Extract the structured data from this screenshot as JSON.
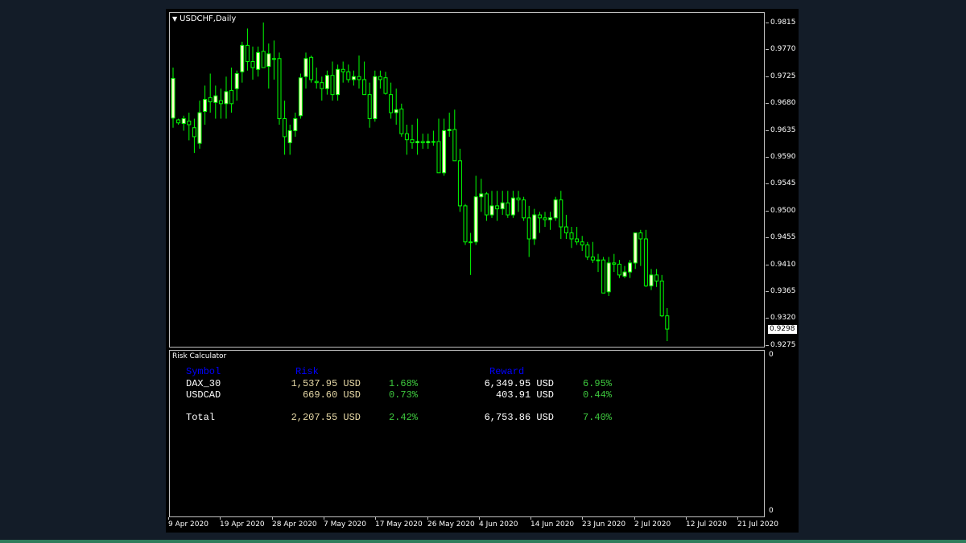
{
  "chart": {
    "symbol_title": "USDCHF,Daily",
    "dropdown_icon": "triangle-down-icon",
    "bull_color": "#ffffcc",
    "bear_color": "#000000",
    "wick_color": "#00ff00",
    "current_price": "0.9298",
    "price_labels": [
      "0.9815",
      "0.9770",
      "0.9725",
      "0.9680",
      "0.9635",
      "0.9590",
      "0.9545",
      "0.9500",
      "0.9455",
      "0.9410",
      "0.9365",
      "0.9320",
      "0.9275"
    ],
    "time_labels": [
      "9 Apr 2020",
      "19 Apr 2020",
      "28 Apr 2020",
      "7 May 2020",
      "17 May 2020",
      "26 May 2020",
      "4 Jun 2020",
      "14 Jun 2020",
      "23 Jun 2020",
      "2 Jul 2020",
      "12 Jul 2020",
      "21 Jul 2020"
    ]
  },
  "chart_data": {
    "type": "candlestick",
    "title": "USDCHF,Daily",
    "ylim": [
      0.9268,
      0.9826
    ],
    "ohlc": [
      [
        0.9651,
        0.9735,
        0.9635,
        0.9717
      ],
      [
        0.9648,
        0.965,
        0.964,
        0.9643
      ],
      [
        0.9642,
        0.9655,
        0.963,
        0.965
      ],
      [
        0.9646,
        0.966,
        0.9614,
        0.964
      ],
      [
        0.9635,
        0.965,
        0.9593,
        0.962
      ],
      [
        0.9609,
        0.968,
        0.96,
        0.966
      ],
      [
        0.9662,
        0.9705,
        0.964,
        0.9682
      ],
      [
        0.9685,
        0.9725,
        0.966,
        0.9678
      ],
      [
        0.9677,
        0.9705,
        0.965,
        0.9688
      ],
      [
        0.968,
        0.97,
        0.965,
        0.9675
      ],
      [
        0.9675,
        0.972,
        0.965,
        0.9695
      ],
      [
        0.9697,
        0.9735,
        0.966,
        0.9675
      ],
      [
        0.97,
        0.973,
        0.968,
        0.9725
      ],
      [
        0.9728,
        0.9778,
        0.971,
        0.9772
      ],
      [
        0.9772,
        0.98,
        0.973,
        0.9745
      ],
      [
        0.9745,
        0.977,
        0.9715,
        0.9735
      ],
      [
        0.9732,
        0.977,
        0.972,
        0.976
      ],
      [
        0.9762,
        0.981,
        0.9735,
        0.9735
      ],
      [
        0.9737,
        0.9775,
        0.97,
        0.9758
      ],
      [
        0.975,
        0.978,
        0.9715,
        0.975
      ],
      [
        0.975,
        0.976,
        0.964,
        0.965
      ],
      [
        0.965,
        0.968,
        0.959,
        0.962
      ],
      [
        0.961,
        0.964,
        0.959,
        0.963
      ],
      [
        0.963,
        0.966,
        0.962,
        0.965
      ],
      [
        0.9655,
        0.9725,
        0.965,
        0.9718
      ],
      [
        0.972,
        0.976,
        0.97,
        0.975
      ],
      [
        0.9752,
        0.9755,
        0.971,
        0.9715
      ],
      [
        0.9712,
        0.9735,
        0.97,
        0.971
      ],
      [
        0.971,
        0.972,
        0.968,
        0.97
      ],
      [
        0.97,
        0.973,
        0.969,
        0.9722
      ],
      [
        0.9722,
        0.9745,
        0.968,
        0.969
      ],
      [
        0.969,
        0.974,
        0.968,
        0.9732
      ],
      [
        0.9732,
        0.9745,
        0.971,
        0.9728
      ],
      [
        0.9728,
        0.974,
        0.971,
        0.9715
      ],
      [
        0.9715,
        0.973,
        0.9705,
        0.972
      ],
      [
        0.972,
        0.9755,
        0.97,
        0.9715
      ],
      [
        0.9715,
        0.9745,
        0.969,
        0.969
      ],
      [
        0.969,
        0.971,
        0.9635,
        0.965
      ],
      [
        0.965,
        0.973,
        0.9645,
        0.972
      ],
      [
        0.972,
        0.973,
        0.97,
        0.9715
      ],
      [
        0.9718,
        0.9728,
        0.969,
        0.9692
      ],
      [
        0.969,
        0.971,
        0.965,
        0.966
      ],
      [
        0.966,
        0.97,
        0.964,
        0.9665
      ],
      [
        0.9666,
        0.9675,
        0.962,
        0.9625
      ],
      [
        0.9625,
        0.964,
        0.959,
        0.9615
      ],
      [
        0.9615,
        0.964,
        0.96,
        0.961
      ],
      [
        0.961,
        0.965,
        0.959,
        0.9612
      ],
      [
        0.9612,
        0.9625,
        0.96,
        0.961
      ],
      [
        0.961,
        0.9625,
        0.96,
        0.9612
      ],
      [
        0.9612,
        0.963,
        0.9605,
        0.9612
      ],
      [
        0.9612,
        0.965,
        0.956,
        0.956
      ],
      [
        0.956,
        0.965,
        0.9555,
        0.963
      ],
      [
        0.963,
        0.966,
        0.962,
        0.9632
      ],
      [
        0.9632,
        0.9665,
        0.958,
        0.958
      ],
      [
        0.958,
        0.96,
        0.9495,
        0.9505
      ],
      [
        0.9505,
        0.9508,
        0.944,
        0.9445
      ],
      [
        0.9445,
        0.946,
        0.939,
        0.9445
      ],
      [
        0.9445,
        0.9555,
        0.944,
        0.952
      ],
      [
        0.952,
        0.955,
        0.9495,
        0.9525
      ],
      [
        0.9525,
        0.9528,
        0.948,
        0.949
      ],
      [
        0.949,
        0.953,
        0.9485,
        0.9505
      ],
      [
        0.9505,
        0.953,
        0.948,
        0.95
      ],
      [
        0.95,
        0.953,
        0.949,
        0.951
      ],
      [
        0.951,
        0.953,
        0.9485,
        0.949
      ],
      [
        0.949,
        0.953,
        0.9485,
        0.9518
      ],
      [
        0.9518,
        0.953,
        0.9495,
        0.9515
      ],
      [
        0.9515,
        0.952,
        0.948,
        0.9485
      ],
      [
        0.9485,
        0.9505,
        0.942,
        0.945
      ],
      [
        0.945,
        0.95,
        0.944,
        0.949
      ],
      [
        0.949,
        0.9495,
        0.946,
        0.9485
      ],
      [
        0.9485,
        0.9495,
        0.947,
        0.9482
      ],
      [
        0.9482,
        0.9495,
        0.9465,
        0.9485
      ],
      [
        0.9485,
        0.952,
        0.948,
        0.9515
      ],
      [
        0.9515,
        0.953,
        0.945,
        0.947
      ],
      [
        0.947,
        0.949,
        0.945,
        0.946
      ],
      [
        0.946,
        0.947,
        0.9435,
        0.945
      ],
      [
        0.945,
        0.947,
        0.944,
        0.9445
      ],
      [
        0.9445,
        0.9455,
        0.943,
        0.944
      ],
      [
        0.944,
        0.9445,
        0.9415,
        0.942
      ],
      [
        0.942,
        0.9445,
        0.941,
        0.9415
      ],
      [
        0.9415,
        0.9425,
        0.9395,
        0.9415
      ],
      [
        0.9415,
        0.942,
        0.936,
        0.936
      ],
      [
        0.9362,
        0.942,
        0.9355,
        0.941
      ],
      [
        0.941,
        0.9425,
        0.9395,
        0.9408
      ],
      [
        0.9408,
        0.9415,
        0.9385,
        0.939
      ],
      [
        0.9388,
        0.9405,
        0.9385,
        0.9395
      ],
      [
        0.9395,
        0.9415,
        0.9385,
        0.941
      ],
      [
        0.941,
        0.946,
        0.94,
        0.946
      ],
      [
        0.946,
        0.9465,
        0.9405,
        0.945
      ],
      [
        0.945,
        0.9465,
        0.937,
        0.9372
      ],
      [
        0.9372,
        0.94,
        0.9365,
        0.939
      ],
      [
        0.939,
        0.94,
        0.937,
        0.938
      ],
      [
        0.938,
        0.939,
        0.932,
        0.9322
      ],
      [
        0.9322,
        0.9335,
        0.928,
        0.93
      ]
    ]
  },
  "risk_calculator": {
    "title": "Risk Calculator",
    "headers": {
      "symbol": "Symbol",
      "risk": "Risk",
      "reward": "Reward"
    },
    "rows": [
      {
        "symbol": "DAX_30",
        "risk_amount": "1,537.95 USD",
        "risk_pct": "1.68%",
        "reward_amount": "6,349.95 USD",
        "reward_pct": "6.95%"
      },
      {
        "symbol": "USDCAD",
        "risk_amount": "669.60 USD",
        "risk_pct": "0.73%",
        "reward_amount": "403.91 USD",
        "reward_pct": "0.44%"
      }
    ],
    "total": {
      "label": "Total",
      "risk_amount": "2,207.55 USD",
      "risk_pct": "2.42%",
      "reward_amount": "6,753.86 USD",
      "reward_pct": "7.40%"
    },
    "scale_top": "0",
    "scale_bottom": "0"
  }
}
